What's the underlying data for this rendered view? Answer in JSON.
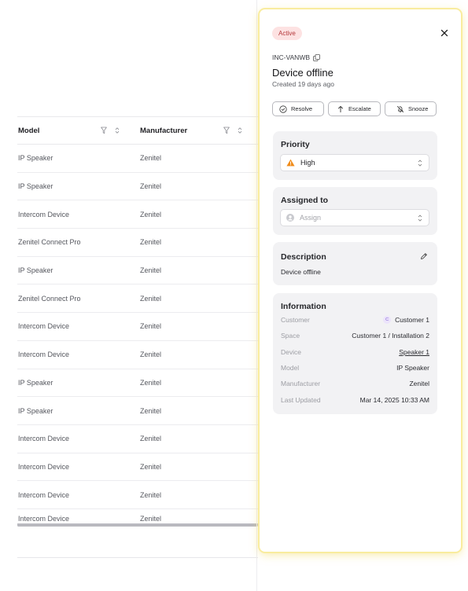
{
  "table": {
    "columns": {
      "model": "Model",
      "manufacturer": "Manufacturer"
    },
    "rows": [
      {
        "model": "IP Speaker",
        "manufacturer": "Zenitel"
      },
      {
        "model": "IP Speaker",
        "manufacturer": "Zenitel"
      },
      {
        "model": "Intercom Device",
        "manufacturer": "Zenitel"
      },
      {
        "model": "Zenitel Connect Pro",
        "manufacturer": "Zenitel"
      },
      {
        "model": "IP Speaker",
        "manufacturer": "Zenitel"
      },
      {
        "model": "Zenitel Connect Pro",
        "manufacturer": "Zenitel"
      },
      {
        "model": "Intercom Device",
        "manufacturer": "Zenitel"
      },
      {
        "model": "Intercom Device",
        "manufacturer": "Zenitel"
      },
      {
        "model": "IP Speaker",
        "manufacturer": "Zenitel"
      },
      {
        "model": "IP Speaker",
        "manufacturer": "Zenitel"
      },
      {
        "model": "Intercom Device",
        "manufacturer": "Zenitel"
      },
      {
        "model": "Intercom Device",
        "manufacturer": "Zenitel"
      },
      {
        "model": "Intercom Device",
        "manufacturer": "Zenitel"
      },
      {
        "model": "Intercom Device",
        "manufacturer": "Zenitel"
      }
    ],
    "icons": {
      "filter": "filter-icon",
      "sort": "sort-icon"
    }
  },
  "panel": {
    "status_badge": "Active",
    "incident_id": "INC-VANWB",
    "title": "Device offline",
    "created": "Created 19 days ago",
    "actions": {
      "resolve": "Resolve",
      "escalate": "Escalate",
      "snooze": "Snooze"
    },
    "priority": {
      "title": "Priority",
      "value": "High"
    },
    "assigned": {
      "title": "Assigned to",
      "placeholder": "Assign"
    },
    "description": {
      "title": "Description",
      "text": "Device offline"
    },
    "information": {
      "title": "Information",
      "customer": {
        "label": "Customer",
        "value": "Customer 1",
        "initial": "C"
      },
      "space": {
        "label": "Space",
        "value": "Customer 1 / Installation 2"
      },
      "device": {
        "label": "Device",
        "value": "Speaker 1"
      },
      "model": {
        "label": "Model",
        "value": "IP Speaker"
      },
      "manufacturer": {
        "label": "Manufacturer",
        "value": "Zenitel"
      },
      "last_updated": {
        "label": "Last Updated",
        "value": "Mar 14, 2025 10:33 AM"
      }
    }
  },
  "colors": {
    "badge_bg": "#fde2e2",
    "badge_text": "#b4373a",
    "priority_high": "#f08c1a",
    "panel_glow": "#f9ec9e"
  }
}
